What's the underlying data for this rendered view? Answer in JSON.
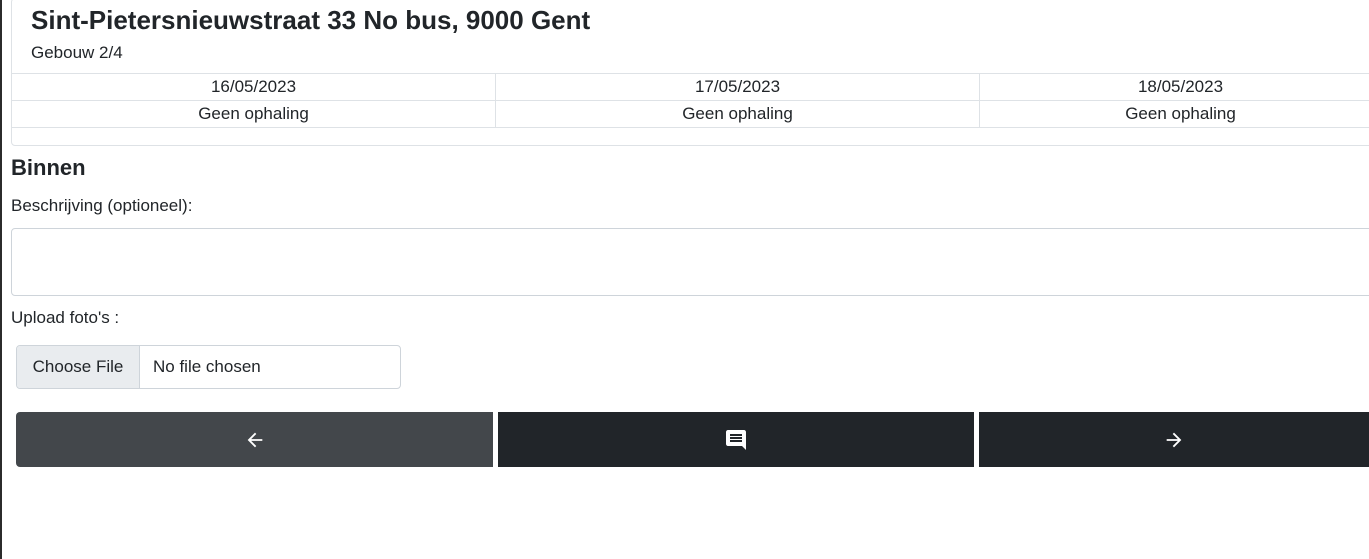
{
  "header": {
    "address": "Sint-Pietersnieuwstraat 33 No bus, 9000 Gent",
    "building": "Gebouw 2/4"
  },
  "schedule": [
    {
      "date": "16/05/2023",
      "status": "Geen ophaling"
    },
    {
      "date": "17/05/2023",
      "status": "Geen ophaling"
    },
    {
      "date": "18/05/2023",
      "status": "Geen ophaling"
    }
  ],
  "section": {
    "title": "Binnen",
    "description_label": "Beschrijving (optioneel):",
    "description_value": "",
    "upload_label": "Upload foto's :",
    "file_button": "Choose File",
    "file_status": "No file chosen"
  },
  "nav": {
    "prev_icon": "arrow-left-icon",
    "comment_icon": "comment-icon",
    "next_icon": "arrow-right-icon"
  },
  "colors": {
    "prev_button": "#43474b",
    "dark_button": "#212529",
    "border": "#dee2e6"
  }
}
